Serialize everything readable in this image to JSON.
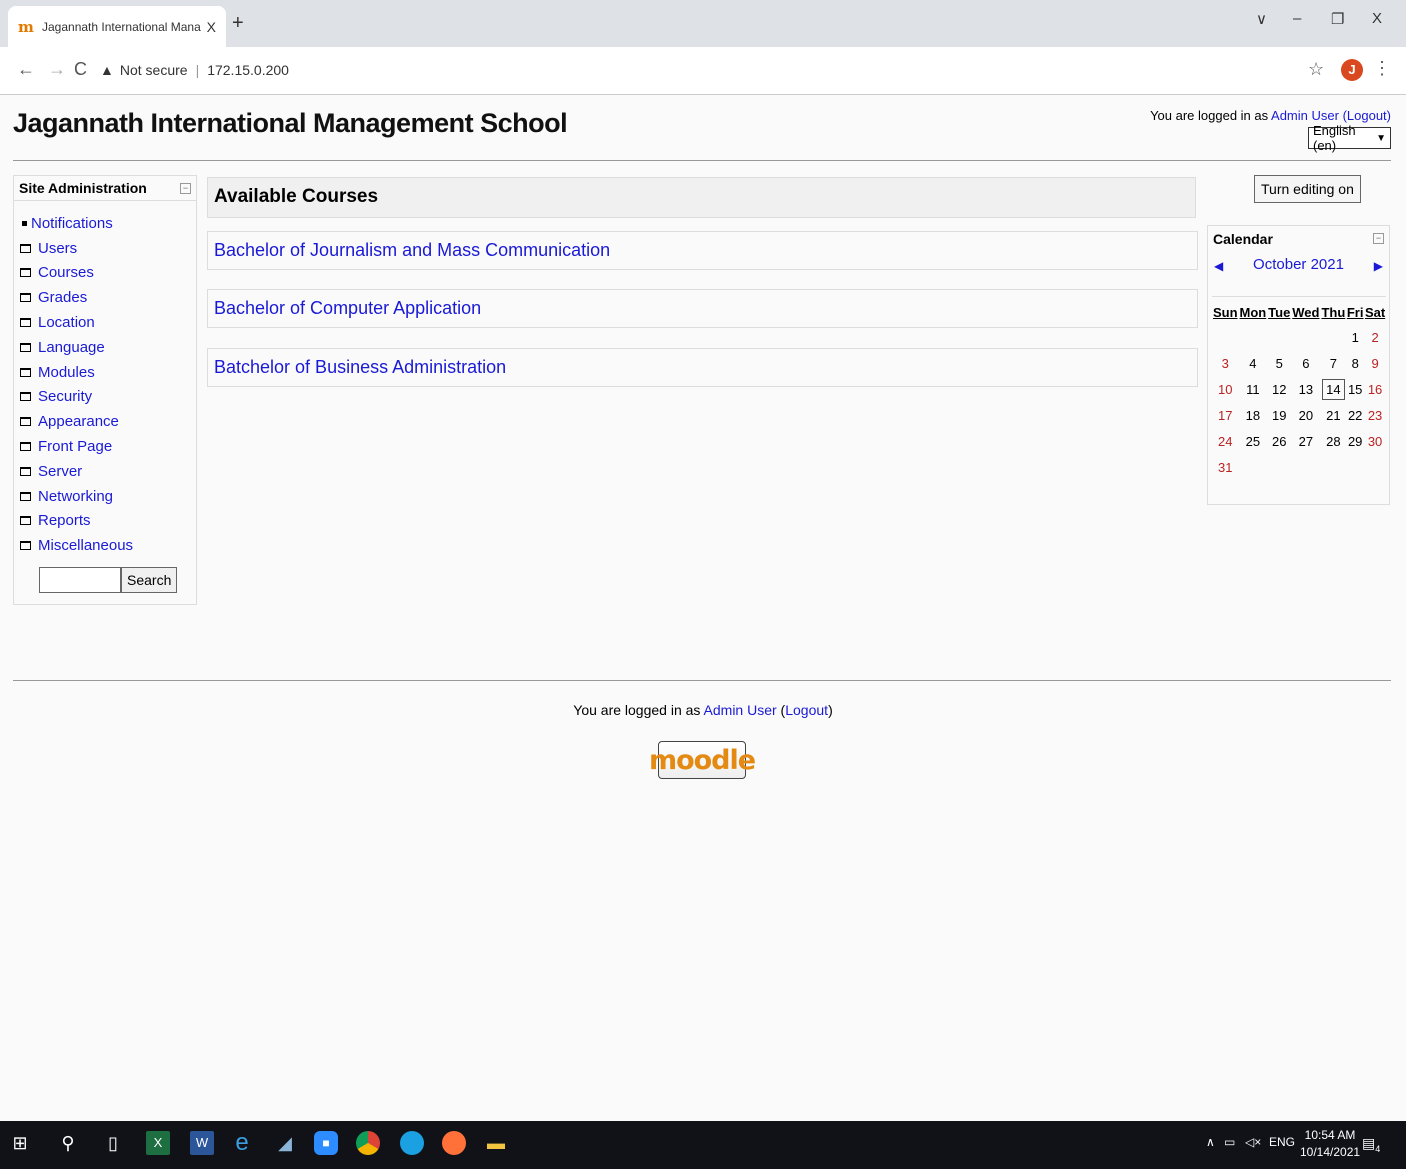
{
  "browser": {
    "tab_title": "Jagannath International Manage",
    "tab_close": "X",
    "new_tab": "+",
    "url_warning": "Not secure",
    "url": "172.15.0.200",
    "avatar_letter": "J",
    "win_min": "–",
    "win_restore": "❐",
    "win_close": "X",
    "tab_menu": "∨"
  },
  "header": {
    "site_title": "Jagannath International Management School",
    "logged_prefix": "You are logged in as ",
    "user_name": "Admin User",
    "logout": "(Logout)",
    "language": "English (en)"
  },
  "site_admin": {
    "title": "Site Administration",
    "items": [
      {
        "label": "Notifications",
        "type": "bullet"
      },
      {
        "label": "Users",
        "type": "folder"
      },
      {
        "label": "Courses",
        "type": "folder"
      },
      {
        "label": "Grades",
        "type": "folder"
      },
      {
        "label": "Location",
        "type": "folder"
      },
      {
        "label": "Language",
        "type": "folder"
      },
      {
        "label": "Modules",
        "type": "folder"
      },
      {
        "label": "Security",
        "type": "folder"
      },
      {
        "label": "Appearance",
        "type": "folder"
      },
      {
        "label": "Front Page",
        "type": "folder"
      },
      {
        "label": "Server",
        "type": "folder"
      },
      {
        "label": "Networking",
        "type": "folder"
      },
      {
        "label": "Reports",
        "type": "folder"
      },
      {
        "label": "Miscellaneous",
        "type": "folder"
      }
    ],
    "search_button": "Search",
    "search_value": ""
  },
  "courses": {
    "heading": "Available Courses",
    "items": [
      "Bachelor of Journalism and Mass Communication",
      "Bachelor of Computer Application",
      "Batchelor of Business Administration"
    ]
  },
  "editing_button": "Turn editing on",
  "calendar": {
    "title": "Calendar",
    "month": "October 2021",
    "days": [
      "Sun",
      "Mon",
      "Tue",
      "Wed",
      "Thu",
      "Fri",
      "Sat"
    ],
    "weeks": [
      [
        "",
        "",
        "",
        "",
        "",
        "1",
        "2"
      ],
      [
        "3",
        "4",
        "5",
        "6",
        "7",
        "8",
        "9"
      ],
      [
        "10",
        "11",
        "12",
        "13",
        "14",
        "15",
        "16"
      ],
      [
        "17",
        "18",
        "19",
        "20",
        "21",
        "22",
        "23"
      ],
      [
        "24",
        "25",
        "26",
        "27",
        "28",
        "29",
        "30"
      ],
      [
        "31",
        "",
        "",
        "",
        "",
        "",
        ""
      ]
    ],
    "today": "14"
  },
  "footer": {
    "logged_prefix": "You are logged in as ",
    "user_name": "Admin User",
    "logout": "Logout",
    "logo_text": "moodle"
  },
  "taskbar": {
    "lang": "ENG",
    "time": "10:54 AM",
    "date": "10/14/2021",
    "notification_count": "4"
  },
  "colors": {
    "link": "#1a1ad6",
    "weekend": "#b22222",
    "moodle_orange": "#e48a12",
    "taskbar": "#101218"
  }
}
